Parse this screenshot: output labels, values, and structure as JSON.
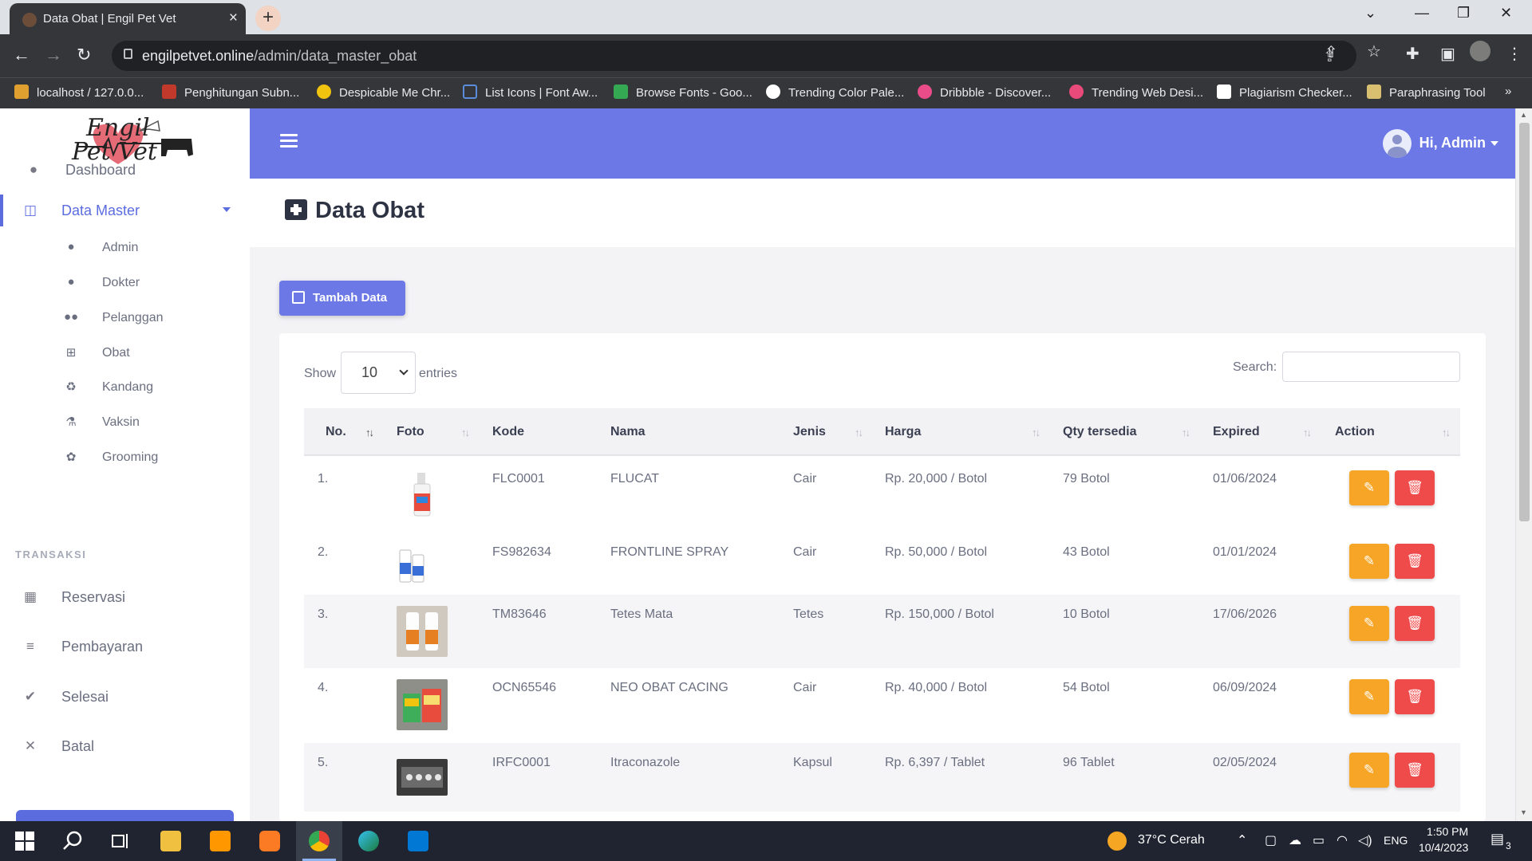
{
  "browser": {
    "tab_title": "Data Obat | Engil Pet Vet",
    "url_host": "engilpetvet.online",
    "url_path": "/admin/data_master_obat",
    "bookmarks": [
      {
        "label": "localhost / 127.0.0...",
        "color": "#e0a030"
      },
      {
        "label": "Penghitungan Subn...",
        "color": "#c0392b"
      },
      {
        "label": "Despicable Me Chr...",
        "color": "#f1c40f"
      },
      {
        "label": "List Icons | Font Aw...",
        "color": "#5b8cd9"
      },
      {
        "label": "Browse Fonts - Goo...",
        "color": "#34a853"
      },
      {
        "label": "Trending Color Pale...",
        "color": "#ffffff"
      },
      {
        "label": "Dribbble - Discover...",
        "color": "#ea4c89"
      },
      {
        "label": "Trending Web Desi...",
        "color": "#e84a7a"
      },
      {
        "label": "Plagiarism Checker...",
        "color": "#ffffff"
      },
      {
        "label": "Paraphrasing Tool",
        "color": "#d8c070"
      }
    ]
  },
  "sidebar": {
    "logo_line1": "Engil",
    "logo_line2": "Pet Vet",
    "dashboard": "Dashboard",
    "data_master": "Data Master",
    "sub_items": [
      "Admin",
      "Dokter",
      "Pelanggan",
      "Obat",
      "Kandang",
      "Vaksin",
      "Grooming"
    ],
    "section_transaksi": "TRANSAKSI",
    "transaksi_items": [
      "Reservasi",
      "Pembayaran",
      "Selesai",
      "Batal"
    ]
  },
  "header": {
    "user_greeting": "Hi, Admin"
  },
  "page": {
    "title": "Data Obat",
    "add_button": "Tambah Data"
  },
  "table": {
    "show_label": "Show",
    "page_size": "10",
    "entries_label": "entries",
    "search_label": "Search:",
    "columns": [
      "No.",
      "Foto",
      "Kode",
      "Nama",
      "Jenis",
      "Harga",
      "Qty tersedia",
      "Expired",
      "Action"
    ],
    "rows": [
      {
        "no": "1.",
        "kode": "FLC0001",
        "nama": "FLUCAT",
        "jenis": "Cair",
        "harga": "Rp. 20,000 / Botol",
        "qty": "79 Botol",
        "expired": "01/06/2024"
      },
      {
        "no": "2.",
        "kode": "FS982634",
        "nama": "FRONTLINE SPRAY",
        "jenis": "Cair",
        "harga": "Rp. 50,000 / Botol",
        "qty": "43 Botol",
        "expired": "01/01/2024"
      },
      {
        "no": "3.",
        "kode": "TM83646",
        "nama": "Tetes Mata",
        "jenis": "Tetes",
        "harga": "Rp. 150,000 / Botol",
        "qty": "10 Botol",
        "expired": "17/06/2026"
      },
      {
        "no": "4.",
        "kode": "OCN65546",
        "nama": "NEO OBAT CACING",
        "jenis": "Cair",
        "harga": "Rp. 40,000 / Botol",
        "qty": "54 Botol",
        "expired": "06/09/2024"
      },
      {
        "no": "5.",
        "kode": "IRFC0001",
        "nama": "Itraconazole",
        "jenis": "Kapsul",
        "harga": "Rp. 6,397 / Tablet",
        "qty": "96 Tablet",
        "expired": "02/05/2024"
      }
    ]
  },
  "taskbar": {
    "weather": "37°C  Cerah",
    "lang": "ENG",
    "time": "1:50 PM",
    "date": "10/4/2023",
    "notif_count": "3"
  },
  "colors": {
    "accent": "#6c78e6",
    "edit": "#f7a526",
    "delete": "#f04b4b"
  }
}
